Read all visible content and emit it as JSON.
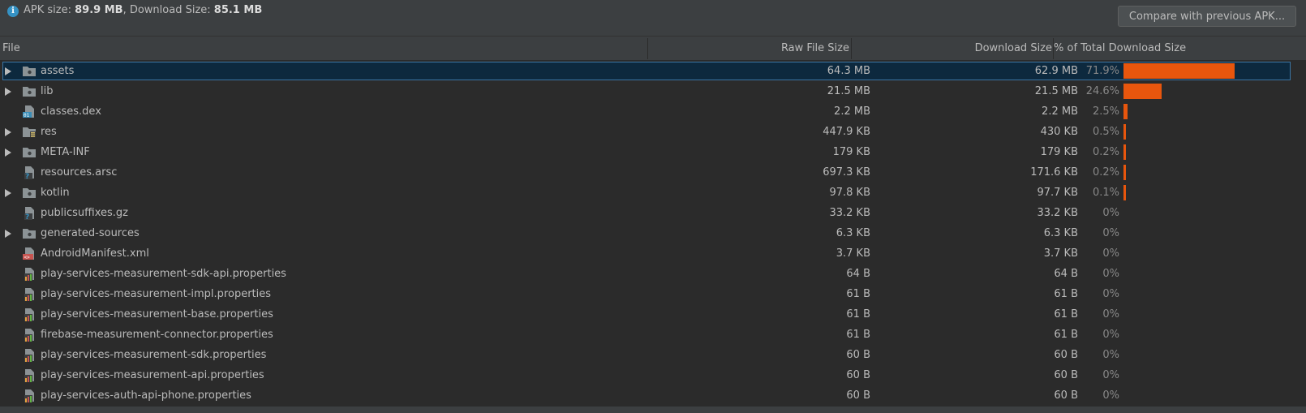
{
  "summary": {
    "apk_label": "APK size: ",
    "apk_value": "89.9 MB",
    "download_label": ", Download Size: ",
    "download_value": "85.1 MB"
  },
  "compare_button": "Compare with previous APK...",
  "columns": {
    "file": "File",
    "raw": "Raw File Size",
    "download": "Download Size",
    "percent": "% of Total Download Size"
  },
  "colors": {
    "bar": "#e8560d",
    "selection": "#0d293e"
  },
  "rows": [
    {
      "name": "assets",
      "raw": "64.3 MB",
      "download": "62.9 MB",
      "percent": "71.9%",
      "share": 71.9,
      "icon": "folder-icon",
      "expandable": true,
      "selected": true
    },
    {
      "name": "lib",
      "raw": "21.5 MB",
      "download": "21.5 MB",
      "percent": "24.6%",
      "share": 24.6,
      "icon": "folder-icon",
      "expandable": true
    },
    {
      "name": "classes.dex",
      "raw": "2.2 MB",
      "download": "2.2 MB",
      "percent": "2.5%",
      "share": 2.5,
      "icon": "dex-file-icon",
      "expandable": false
    },
    {
      "name": "res",
      "raw": "447.9 KB",
      "download": "430 KB",
      "percent": "0.5%",
      "share": 0.5,
      "icon": "resource-folder-icon",
      "expandable": true
    },
    {
      "name": "META-INF",
      "raw": "179 KB",
      "download": "179 KB",
      "percent": "0.2%",
      "share": 0.2,
      "icon": "folder-icon",
      "expandable": true
    },
    {
      "name": "resources.arsc",
      "raw": "697.3 KB",
      "download": "171.6 KB",
      "percent": "0.2%",
      "share": 0.2,
      "icon": "unknown-file-icon",
      "expandable": false
    },
    {
      "name": "kotlin",
      "raw": "97.8 KB",
      "download": "97.7 KB",
      "percent": "0.1%",
      "share": 0.1,
      "icon": "folder-icon",
      "expandable": true
    },
    {
      "name": "publicsuffixes.gz",
      "raw": "33.2 KB",
      "download": "33.2 KB",
      "percent": "0%",
      "share": 0,
      "icon": "unknown-file-icon",
      "expandable": false
    },
    {
      "name": "generated-sources",
      "raw": "6.3 KB",
      "download": "6.3 KB",
      "percent": "0%",
      "share": 0,
      "icon": "folder-icon",
      "expandable": true
    },
    {
      "name": "AndroidManifest.xml",
      "raw": "3.7 KB",
      "download": "3.7 KB",
      "percent": "0%",
      "share": 0,
      "icon": "xml-file-icon",
      "expandable": false
    },
    {
      "name": "play-services-measurement-sdk-api.properties",
      "raw": "64 B",
      "download": "64 B",
      "percent": "0%",
      "share": 0,
      "icon": "properties-file-icon",
      "expandable": false
    },
    {
      "name": "play-services-measurement-impl.properties",
      "raw": "61 B",
      "download": "61 B",
      "percent": "0%",
      "share": 0,
      "icon": "properties-file-icon",
      "expandable": false
    },
    {
      "name": "play-services-measurement-base.properties",
      "raw": "61 B",
      "download": "61 B",
      "percent": "0%",
      "share": 0,
      "icon": "properties-file-icon",
      "expandable": false
    },
    {
      "name": "firebase-measurement-connector.properties",
      "raw": "61 B",
      "download": "61 B",
      "percent": "0%",
      "share": 0,
      "icon": "properties-file-icon",
      "expandable": false
    },
    {
      "name": "play-services-measurement-sdk.properties",
      "raw": "60 B",
      "download": "60 B",
      "percent": "0%",
      "share": 0,
      "icon": "properties-file-icon",
      "expandable": false
    },
    {
      "name": "play-services-measurement-api.properties",
      "raw": "60 B",
      "download": "60 B",
      "percent": "0%",
      "share": 0,
      "icon": "properties-file-icon",
      "expandable": false
    },
    {
      "name": "play-services-auth-api-phone.properties",
      "raw": "60 B",
      "download": "60 B",
      "percent": "0%",
      "share": 0,
      "icon": "properties-file-icon",
      "expandable": false
    }
  ]
}
